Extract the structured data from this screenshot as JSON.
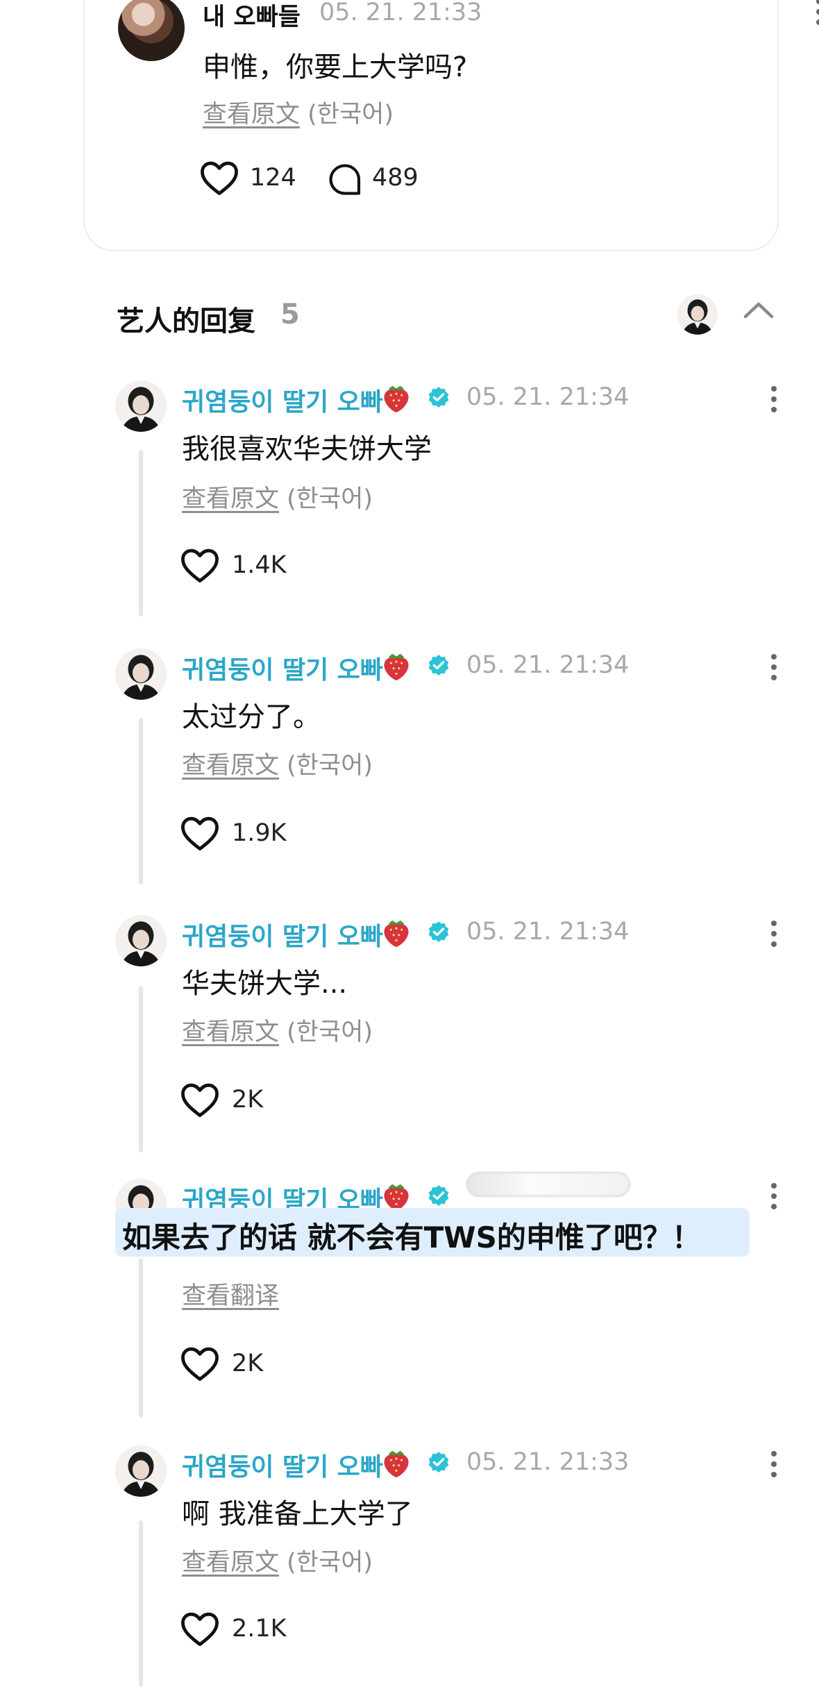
{
  "post": {
    "author": "내 오빠들",
    "time": "05. 21. 21:33",
    "text": "申惟，你要上大学吗?",
    "see_original": "查看原文",
    "language": "(한국어)",
    "likes": "124",
    "comments": "489"
  },
  "replies_header": {
    "title": "艺人的回复",
    "count": "5"
  },
  "replies": [
    {
      "author": "귀염둥이 딸기 오빠",
      "time": "05. 21. 21:34",
      "text": "我很喜欢华夫饼大学",
      "see_original": "查看原文",
      "language": "(한국어)",
      "likes": "1.4K"
    },
    {
      "author": "귀염둥이 딸기 오빠",
      "time": "05. 21. 21:34",
      "text": "太过分了。",
      "see_original": "查看原文",
      "language": "(한국어)",
      "likes": "1.9K"
    },
    {
      "author": "귀염둥이 딸기 오빠",
      "time": "05. 21. 21:34",
      "text": "华夫饼大学...",
      "see_original": "查看原文",
      "language": "(한국어)",
      "likes": "2K"
    },
    {
      "author": "귀염둥이 딸기 오빠",
      "time": "",
      "text": "如果去了的话 就不会有TWS的申惟了吧？！",
      "see_original": "查看翻译",
      "language": "",
      "likes": "2K"
    },
    {
      "author": "귀염둥이 딸기 오빠",
      "time": "05. 21. 21:33",
      "text": "啊 我准备上大学了",
      "see_original": "查看原文",
      "language": "(한국어)",
      "likes": "2.1K"
    }
  ],
  "colors": {
    "artist_name": "#2aa6c9",
    "verified_badge": "#2bc3d6",
    "timestamp": "#a8a8a8",
    "highlight": "#dfeefd"
  },
  "icons": {
    "like": "heart-outline-icon",
    "comment": "speech-bubble-outline-icon",
    "more": "vertical-dots-icon",
    "collapse": "chevron-up-icon",
    "verified": "verified-badge-icon",
    "emoji": "strawberry-icon"
  }
}
